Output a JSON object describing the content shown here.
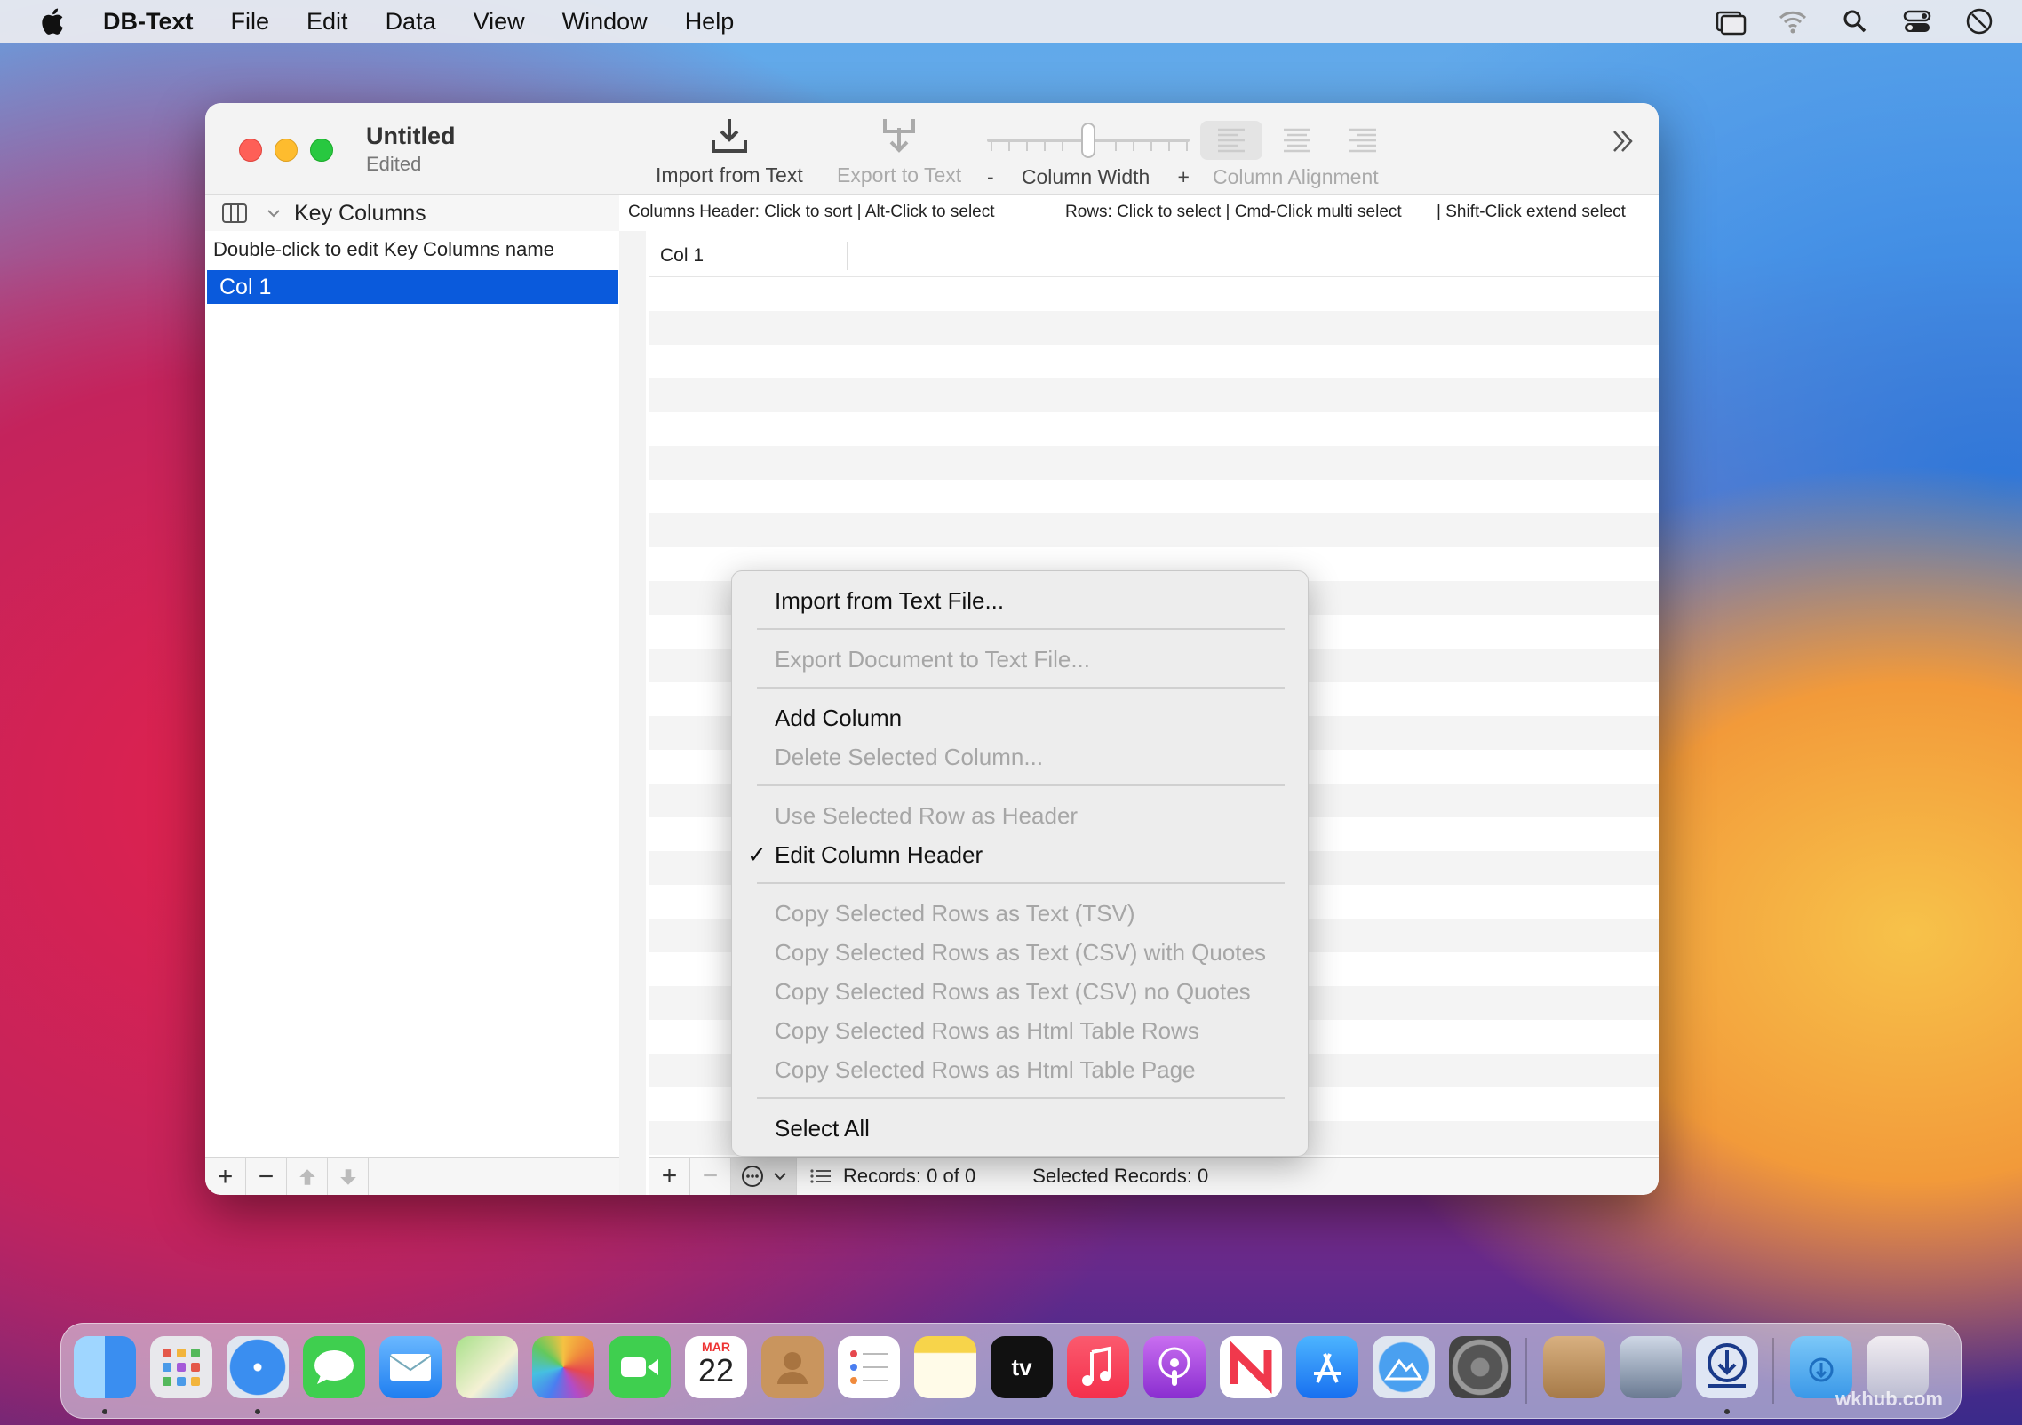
{
  "menubar": {
    "app_name": "DB-Text",
    "items": [
      "File",
      "Edit",
      "Data",
      "View",
      "Window",
      "Help"
    ],
    "right_icons": [
      "display-icon",
      "wifi-icon",
      "search-icon",
      "control-center-icon",
      "screen-time-icon"
    ]
  },
  "window": {
    "title": "Untitled",
    "subtitle": "Edited",
    "toolbar": {
      "import_label": "Import from Text",
      "export_label": "Export to Text",
      "minus_label": "-",
      "column_width_label": "Column Width",
      "plus_label": "+",
      "column_alignment_label": "Column Alignment"
    },
    "left": {
      "header_title": "Key Columns",
      "hint": "Double-click to edit Key Columns name",
      "rows": [
        "Col 1"
      ]
    },
    "right": {
      "hint_header": "Columns Header: Click to sort | Alt-Click to select",
      "hint_rows": "Rows: Click to select | Cmd-Click multi select",
      "hint_shift": "| Shift-Click extend select",
      "columns": [
        "Col 1"
      ],
      "records_label": "Records: 0 of 0",
      "selected_label": "Selected Records: 0"
    }
  },
  "context_menu": {
    "import": "Import  from Text File...",
    "export": "Export Document to Text File...",
    "add_column": "Add Column",
    "delete_column": "Delete Selected Column...",
    "use_row_header": "Use Selected Row as Header",
    "edit_header": "Edit Column Header",
    "edit_header_checked": true,
    "copy_tsv": "Copy Selected Rows as Text (TSV)",
    "copy_csv_quotes": "Copy Selected Rows as Text (CSV) with Quotes",
    "copy_csv_noquotes": "Copy Selected Rows as Text (CSV) no Quotes",
    "copy_html_rows": "Copy Selected Rows as Html Table Rows",
    "copy_html_page": "Copy Selected Rows as Html Table Page",
    "select_all": "Select All"
  },
  "dock": {
    "calendar_month": "MAR",
    "calendar_day": "22",
    "tv_label": "tv",
    "apps": [
      "finder",
      "launchpad",
      "safari",
      "messages",
      "mail",
      "maps",
      "photos",
      "facetime",
      "calendar",
      "contacts",
      "reminders",
      "notes",
      "tv",
      "music",
      "podcasts",
      "news",
      "app-store",
      "altitude",
      "system-preferences",
      "archive-utility",
      "preview",
      "db-text",
      "downloads",
      "trash"
    ]
  },
  "watermark": "wkhub.com",
  "colors": {
    "selection_blue": "#0a5adc",
    "close_red": "#fe5f57",
    "minimize_yellow": "#febc2e",
    "zoom_green": "#28c840"
  }
}
